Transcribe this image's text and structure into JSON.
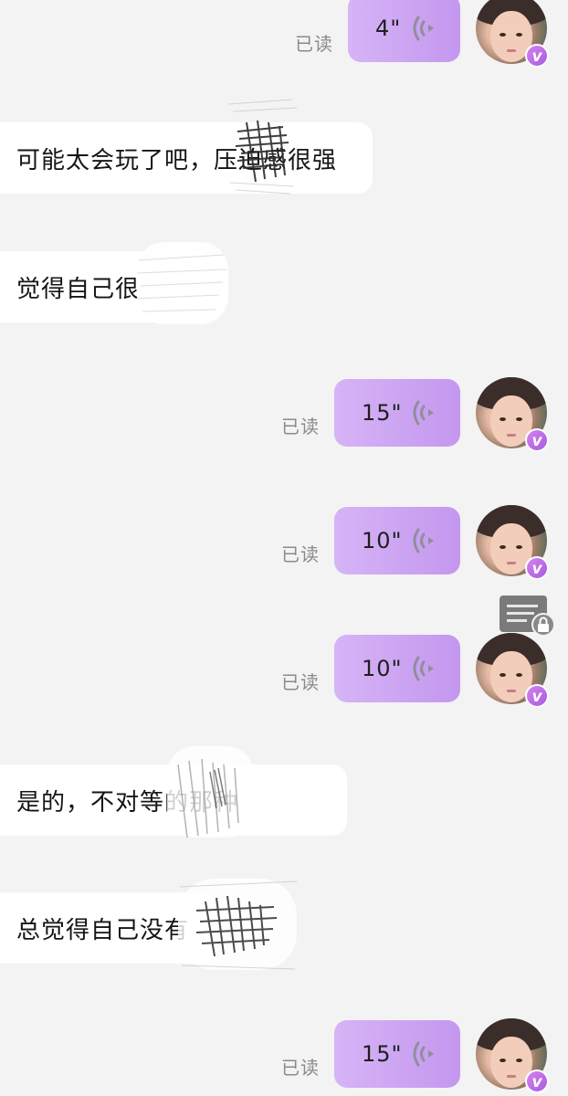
{
  "read_label": "已读",
  "avatar_badge": "v",
  "messages": [
    {
      "dir": "out",
      "type": "voice",
      "duration": "4\""
    },
    {
      "dir": "in",
      "type": "text",
      "text": "可能太会玩了吧，压迫感很强"
    },
    {
      "dir": "in",
      "type": "text",
      "text": "觉得自己很"
    },
    {
      "dir": "out",
      "type": "voice",
      "duration": "15\""
    },
    {
      "dir": "out",
      "type": "voice",
      "duration": "10\""
    },
    {
      "dir": "out",
      "type": "voice",
      "duration": "10\""
    },
    {
      "dir": "in",
      "type": "text",
      "text": "是的，不对等的那种"
    },
    {
      "dir": "in",
      "type": "text",
      "text": "总觉得自己没有"
    },
    {
      "dir": "out",
      "type": "voice",
      "duration": "15\""
    }
  ],
  "icons": {
    "voice_wave": "voice-wave-icon",
    "note_lock": "note-lock-icon",
    "vip_badge": "vip-badge-icon"
  },
  "colors": {
    "background": "#f3f3f3",
    "voice_bubble": "#c8a0f2",
    "incoming_bubble": "#ffffff",
    "badge": "#c26ee9"
  }
}
